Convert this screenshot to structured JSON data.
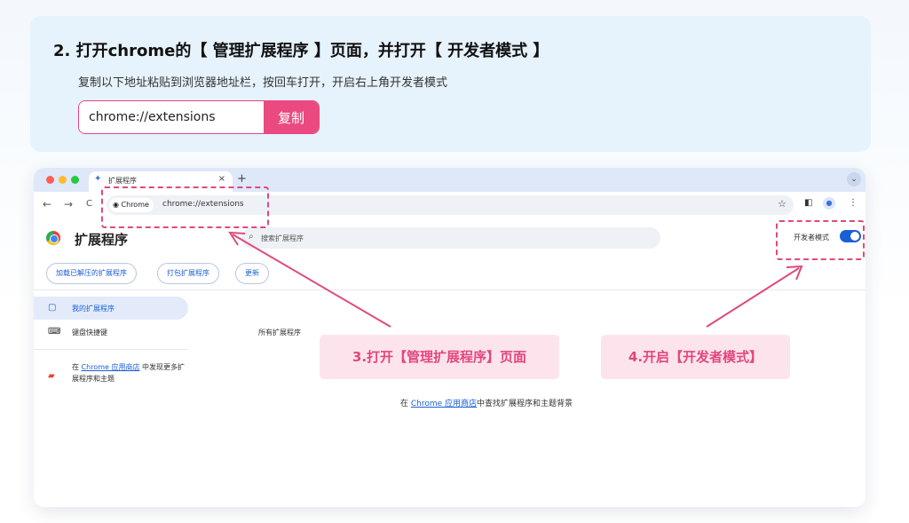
{
  "step": {
    "title": "2. 打开chrome的【 管理扩展程序 】页面，并打开【 开发者模式 】",
    "description": "复制以下地址粘贴到浏览器地址栏，按回车打开，开启右上角开发者模式",
    "url_value": "chrome://extensions",
    "copy_label": "复制"
  },
  "browser": {
    "tab_title": "扩展程序",
    "tab_close": "×",
    "new_tab": "+",
    "tab_menu": "⌄",
    "nav_back": "←",
    "nav_forward": "→",
    "nav_reload": "C",
    "chip_label": "Chrome",
    "address": "chrome://extensions",
    "star": "☆",
    "page_title": "扩展程序",
    "search_placeholder": "搜索扩展程序",
    "dev_mode_label": "开发者模式",
    "dev_mode_on": true,
    "buttons": {
      "load_unpacked": "加载已解压的扩展程序",
      "pack": "打包扩展程序",
      "update": "更新"
    },
    "sidebar": {
      "my_extensions": "我的扩展程序",
      "shortcuts": "键盘快捷键",
      "store_prefix": "在 ",
      "store_link": "Chrome 应用商店",
      "store_suffix": " 中发现更多扩展程序和主题"
    },
    "all_extensions": "所有扩展程序",
    "empty_prefix": "在 ",
    "empty_link": "Chrome 应用商店",
    "empty_suffix": "中查找扩展程序和主题背景"
  },
  "callouts": {
    "step3": "3.打开【管理扩展程序】页面",
    "step4": "4.开启【开发者模式】"
  },
  "colors": {
    "accent_pink": "#ea4a80",
    "card_blue": "#e6f2fc",
    "chrome_blue": "#1a5fd6"
  }
}
